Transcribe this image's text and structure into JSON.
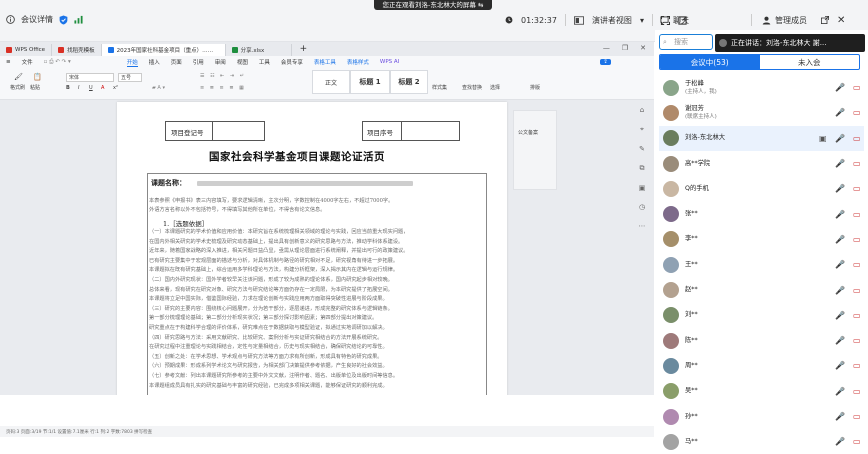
{
  "meeting": {
    "details_label": "会议详情",
    "banner": "您正在观看刘洛-东北林大的屏幕",
    "timer": "01:32:37",
    "view_mode": "演讲者视图",
    "chat_tab": "聊天",
    "members_tab": "管理成员"
  },
  "wps": {
    "tabs": [
      {
        "label": "WPS Office",
        "color": "#d93025"
      },
      {
        "label": "找稻壳模板",
        "color": "#d93025"
      },
      {
        "label": "2023年国家社科基金项目（重点）……",
        "color": "#1a73e8"
      },
      {
        "label": "分享.xlsx",
        "color": "#1e8e3e"
      }
    ],
    "menu": [
      "文件",
      "开始",
      "插入",
      "页面",
      "引用",
      "审阅",
      "视图",
      "工具",
      "会员专享",
      "表格工具",
      "表格样式",
      "WPS AI"
    ],
    "font_name": "宋体",
    "font_size": "五号",
    "style_items": [
      "正文",
      "标题 1",
      "标题 2"
    ],
    "ribbon_labels": [
      "格式刷",
      "粘贴",
      "样式集",
      "查找替换",
      "选择",
      "排版"
    ],
    "side_panel_label": "公文备案",
    "status_text": "页码:3  页面:3/19  节:1/1  设置值:7.1厘米  行:1  列:2  字数:7803  拼写检查"
  },
  "document": {
    "table_label_1": "项目登记号",
    "table_label_2": "项目序号",
    "title": "国家社会科学基金项目课题论证活页",
    "topic_label": "课题名称：",
    "intro_line_1": "本表参照《申报书》表三内容填写，要求逻辑清晰，主次分明，字数控制在4000字左右，不超过7000字。",
    "intro_line_2": "外语方言名称以外不包括符号，不得填写其他所在单位，不得含有论文信息。",
    "section_1": "1.［选题依据］",
    "paragraphs": [
      "（一）本课题研究的学术价值和应用价值：本研究旨在系统梳理相关领域的理论与实践，回应当前重大现实问题，",
      "在国内外相关研究的学术史梳理及研究动态基础上，提出具有创新意义的研究思路与方法，推动学科体系建设。",
      "近年来，随着国家战略的深入推进，相关问题日益凸显，亟需从理论层面进行系统阐释，并提出可行的政策建议。",
      "已有研究主要集中于宏观层面的描述与分析，对具体机制与路径的研究相对不足，研究视角有待进一步拓展。",
      "本课题拟在既有研究基础上，综合运用多学科理论与方法，构建分析框架，深入揭示其内在逻辑与运行规律。",
      "（二）国内外研究现状：国外学者较早关注该问题，形成了较为成熟的理论体系，国内研究起步相对较晚。",
      "总体来看，现有研究在研究对象、研究方法与研究结论等方面仍存在一定局限，为本研究提供了拓展空间。",
      "本课题将立足中国实际，借鉴国际经验，力求在理论创新与实践应用两方面取得突破性进展与阶段成果。",
      "（三）研究的主要内容：围绕核心问题展开，分为若干部分，逐层递进，形成完整的研究体系与逻辑链条。",
      "第一部分梳理理论基础；第二部分分析现实状况；第三部分探讨影响因素；第四部分提出对策建议。",
      "研究重点在于构建科学合理的评价体系，研究难点在于数据获取与模型验证，拟通过实地调研加以解决。",
      "（四）研究思路与方法：采用文献研究、比较研究、案例分析与实证研究相结合的方法开展系统研究。",
      "在研究过程中注重理论与实践相结合，定性与定量相结合，历史与现实相结合，确保研究结论的可靠性。",
      "（五）创新之处：在学术思想、学术观点与研究方法等方面力求有所创新，形成具有特色的研究成果。",
      "（六）预期成果：形成系列学术论文与研究报告，为相关部门决策提供参考依据，产生良好的社会效益。",
      "（七）参考文献：列出本课题研究所参考的主要中外文文献，注明作者、题名、出版单位及出版时间等信息。",
      "本课题组成员具有扎实的研究基础与丰富的研究经验，已完成多项相关课题，能够保证研究的顺利完成。"
    ]
  },
  "panel": {
    "search_placeholder": "搜索",
    "speaking": "正在讲话：刘洛-东北林大 謝...",
    "in_meeting": "会议中(53)",
    "not_joined": "未入会",
    "participants": [
      {
        "name": "于松峰",
        "role": "(主持人，我)",
        "color": "#8aa58a"
      },
      {
        "name": "谢冠芳",
        "role": "(联席主持人)",
        "color": "#b08a6a"
      },
      {
        "name": "刘洛-东北林大",
        "role": "",
        "color": "#6a7d5e"
      },
      {
        "name": "高**学院",
        "role": "",
        "color": "#9a8c7a"
      },
      {
        "name": "Q的手机",
        "role": "",
        "color": "#c9b7a3"
      },
      {
        "name": "张**",
        "role": "",
        "color": "#7d6a8a"
      },
      {
        "name": "李**",
        "role": "",
        "color": "#a58f6a"
      },
      {
        "name": "王**",
        "role": "",
        "color": "#8fa1b3"
      },
      {
        "name": "赵**",
        "role": "",
        "color": "#b3a18f"
      },
      {
        "name": "刘**",
        "role": "",
        "color": "#7a8f6a"
      },
      {
        "name": "陈**",
        "role": "",
        "color": "#9e7a7a"
      },
      {
        "name": "周**",
        "role": "",
        "color": "#6a8a9e"
      },
      {
        "name": "吴**",
        "role": "",
        "color": "#8a9e6a"
      },
      {
        "name": "孙**",
        "role": "",
        "color": "#b08ab0"
      },
      {
        "name": "马**",
        "role": "",
        "color": "#a3a3a3"
      }
    ]
  }
}
